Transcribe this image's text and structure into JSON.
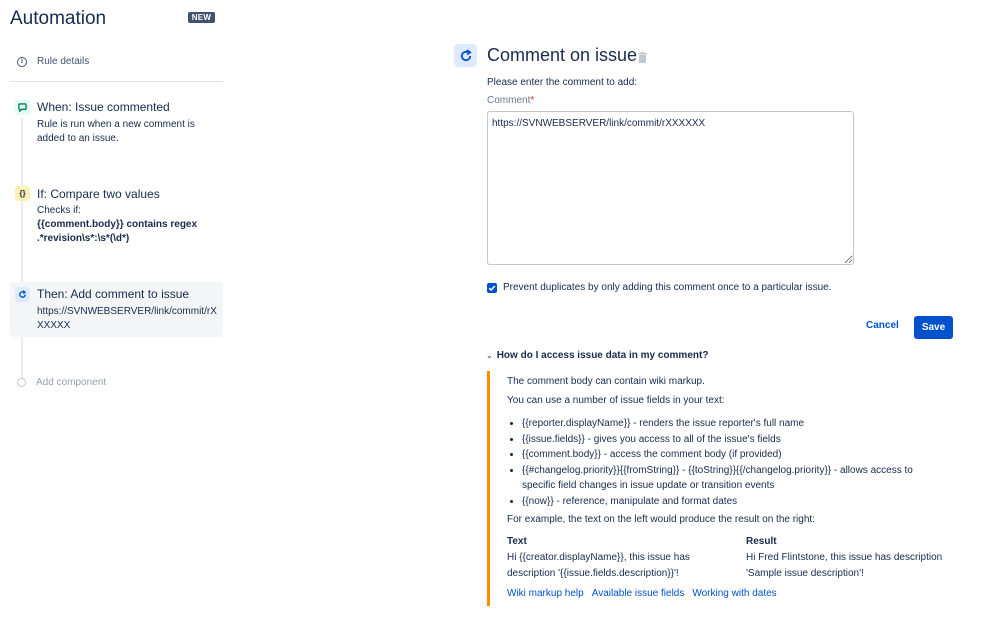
{
  "sidebar": {
    "app_title": "Automation",
    "badge": "NEW",
    "rule_details": "Rule details",
    "steps": [
      {
        "icon": "comment-icon",
        "title": "When: Issue commented",
        "description": "Rule is run when a new comment is added to an issue."
      },
      {
        "icon": "braces-icon",
        "title": "If: Compare two values",
        "description_prefix": "Checks if:",
        "description_bold": "{{comment.body}} contains regex .*revision\\s*:\\s*(\\d*)"
      },
      {
        "icon": "refresh-icon",
        "title": "Then: Add comment to issue",
        "description": "https://SVNWEBSERVER/link/commit/rXXXXXX"
      }
    ],
    "add_component": "Add component"
  },
  "main": {
    "title": "Comment on issue",
    "instruction": "Please enter the comment to add:",
    "comment_label": "Comment",
    "required_mark": "*",
    "comment_value": "https://SVNWEBSERVER/link/commit/rXXXXXX",
    "prevent_duplicates_label": "Prevent duplicates by only adding this comment once to a particular issue.",
    "prevent_duplicates_checked": true,
    "cancel_label": "Cancel",
    "save_label": "Save"
  },
  "help": {
    "toggle_label": "How do I access issue data in my comment?",
    "intro": "The comment body can contain wiki markup.",
    "intro2": "You can use a number of issue fields in your text:",
    "items": [
      "{{reporter.displayName}} - renders the issue reporter's full name",
      "{{issue.fields}} - gives you access to all of the issue's fields",
      "{{comment.body}} - access the comment body (if provided)",
      "{{#changelog.priority}}{{fromString}} - {{toString}}{{/changelog.priority}} - allows access to specific field changes in issue update or transition events",
      "{{now}} - reference, manipulate and format dates"
    ],
    "example_intro": "For example, the text on the left would produce the result on the right:",
    "text_heading": "Text",
    "text_body": "Hi {{creator.displayName}}, this issue has description '{{issue.fields.description}}'!",
    "result_heading": "Result",
    "result_body": "Hi Fred Flintstone, this issue has description 'Sample issue description'!",
    "links": [
      "Wiki markup help",
      "Available issue fields",
      "Working with dates"
    ]
  },
  "colors": {
    "primary": "#0052cc",
    "accent_bar": "#ff8b00",
    "trigger_green": "#00875a",
    "condition_yellow": "#fff0b3"
  }
}
